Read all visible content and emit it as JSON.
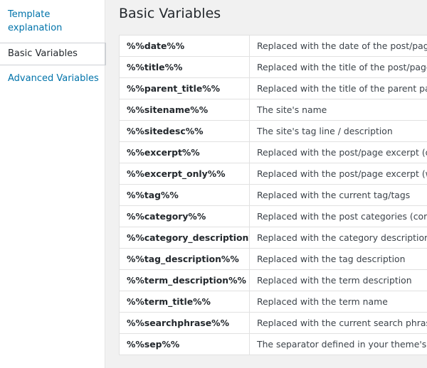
{
  "sidebar": {
    "items": [
      {
        "label": "Template explanation",
        "state": "link"
      },
      {
        "label": "Basic Variables",
        "state": "active"
      },
      {
        "label": "Advanced Variables",
        "state": "link"
      }
    ]
  },
  "main": {
    "title": "Basic Variables",
    "rows": [
      {
        "name": "%%date%%",
        "desc": "Replaced with the date of the post/page"
      },
      {
        "name": "%%title%%",
        "desc": "Replaced with the title of the post/page"
      },
      {
        "name": "%%parent_title%%",
        "desc": "Replaced with the title of the parent page c"
      },
      {
        "name": "%%sitename%%",
        "desc": "The site's name"
      },
      {
        "name": "%%sitedesc%%",
        "desc": "The site's tag line / description"
      },
      {
        "name": "%%excerpt%%",
        "desc": "Replaced with the post/page excerpt (or au"
      },
      {
        "name": "%%excerpt_only%%",
        "desc": "Replaced with the post/page excerpt (witho"
      },
      {
        "name": "%%tag%%",
        "desc": "Replaced with the current tag/tags"
      },
      {
        "name": "%%category%%",
        "desc": "Replaced with the post categories (comma"
      },
      {
        "name": "%%category_description%%",
        "desc": "Replaced with the category description"
      },
      {
        "name": "%%tag_description%%",
        "desc": "Replaced with the tag description"
      },
      {
        "name": "%%term_description%%",
        "desc": "Replaced with the term description"
      },
      {
        "name": "%%term_title%%",
        "desc": "Replaced with the term name"
      },
      {
        "name": "%%searchphrase%%",
        "desc": "Replaced with the current search phrase"
      },
      {
        "name": "%%sep%%",
        "desc": "The separator defined in your theme's",
        "code": "wp"
      }
    ]
  },
  "colors": {
    "link": "#0073aa",
    "text": "#23282d",
    "background": "#f1f1f1",
    "border": "#e1e1e1"
  }
}
